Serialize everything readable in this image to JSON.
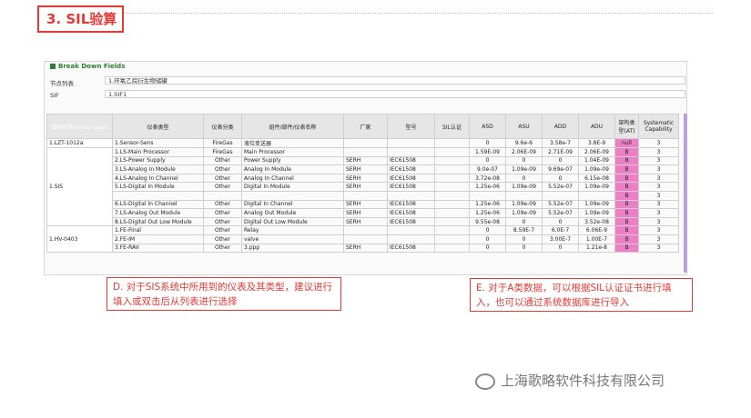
{
  "section_label": "3. SIL验算",
  "panel": {
    "title": "Break Down Fields",
    "node_list_label": "节点列表",
    "node_list_value": "1.环氧乙烷衍生物储罐",
    "sif_label": "SIF",
    "sif_value": "1.SIF1"
  },
  "table": {
    "headers": [
      "组件位号(Group Legs)",
      "仪表类型",
      "仪表分类",
      "组件/部件/仪表名称",
      "厂家",
      "型号",
      "SIL认证",
      "ASD",
      "ASU",
      "ADD",
      "ADU",
      "架构类型(AT)",
      "Systematic Capability"
    ],
    "groups": [
      {
        "label": "1.LZT-1012a",
        "rows": [
          [
            "1.Sensor-Sens",
            "FireGas",
            "液位变送器",
            "",
            "",
            "",
            "0",
            "9.6e-6",
            "3.58e-7",
            "3.8E-9",
            "null",
            "3"
          ]
        ]
      },
      {
        "label": "1.SIS",
        "rows": [
          [
            "1.LS-Main Processor",
            "FireGas",
            "Main Processor",
            "",
            "",
            "",
            "1.59E-09",
            "2.06E-09",
            "2.71E-09",
            "2.06E-09",
            "B",
            "3"
          ],
          [
            "2.LS-Power Supply",
            "Other",
            "Power Supply",
            "SERH",
            "IEC61508",
            "",
            "0",
            "0",
            "0",
            "1.04E-09",
            "B",
            "3"
          ],
          [
            "3.LS-Analog In Module",
            "Other",
            "Analog In Module",
            "SERH",
            "IEC61508",
            "",
            "9.0e-07",
            "1.09e-09",
            "9.69e-07",
            "1.09e-09",
            "B",
            "3"
          ],
          [
            "4.LS-Analog In Channel",
            "Other",
            "Analog In Channel",
            "SERH",
            "IEC61508",
            "",
            "3.72e-08",
            "0",
            "0",
            "6.15e-08",
            "B",
            "3"
          ],
          [
            "5.LS-Digital In Module",
            "Other",
            "Digital In Module",
            "SERH",
            "IEC61508",
            "",
            "1.25e-06",
            "1.09e-09",
            "5.52e-07",
            "1.09e-09",
            "B",
            "3"
          ],
          [
            "",
            "",
            "",
            "",
            "",
            "",
            "",
            "",
            "",
            "",
            "B",
            "3"
          ],
          [
            "6.LS-Digital In Channel",
            "Other",
            "Digital In Channel",
            "SERH",
            "IEC61508",
            "",
            "1.25e-06",
            "1.09e-09",
            "5.52e-07",
            "1.09e-09",
            "B",
            "3"
          ],
          [
            "7.LS-Analog Out Module",
            "Other",
            "Analog Out Module",
            "SERH",
            "IEC61508",
            "",
            "1.25e-06",
            "1.09e-09",
            "5.52e-07",
            "1.09e-09",
            "B",
            "3"
          ],
          [
            "8.LS-Digital Out Low Module",
            "Other",
            "Digital Out Low Module",
            "SERH",
            "IEC61508",
            "",
            "9.55e-08",
            "0",
            "0",
            "3.52e-08",
            "B",
            "3"
          ]
        ]
      },
      {
        "label": "1.HV-0403",
        "rows": [
          [
            "1.FE-Final",
            "Other",
            "Relay",
            "",
            "",
            "",
            "0",
            "8.59E-7",
            "6.0E-7",
            "6.06E-9",
            "B",
            "3"
          ],
          [
            "2.FE-IM",
            "Other",
            "valve",
            "",
            "",
            "",
            "0",
            "0",
            "3.00E-7",
            "1.00E-7",
            "B",
            "3"
          ],
          [
            "3.FE-RAV",
            "Other",
            "3.ppp",
            "SERH",
            "IEC61508",
            "",
            "0",
            "0",
            "0",
            "1.21e-8",
            "B",
            "3"
          ]
        ]
      }
    ]
  },
  "callouts": {
    "d": "D. 对于SIS系统中所用到的仪表及其类型，建议进行填入或双击后从列表进行选择",
    "e": "E. 对于A类数据，可以根据SIL认证证书进行填入，也可以通过系统数据库进行导入"
  },
  "watermark": "上海歌略软件科技有限公司"
}
